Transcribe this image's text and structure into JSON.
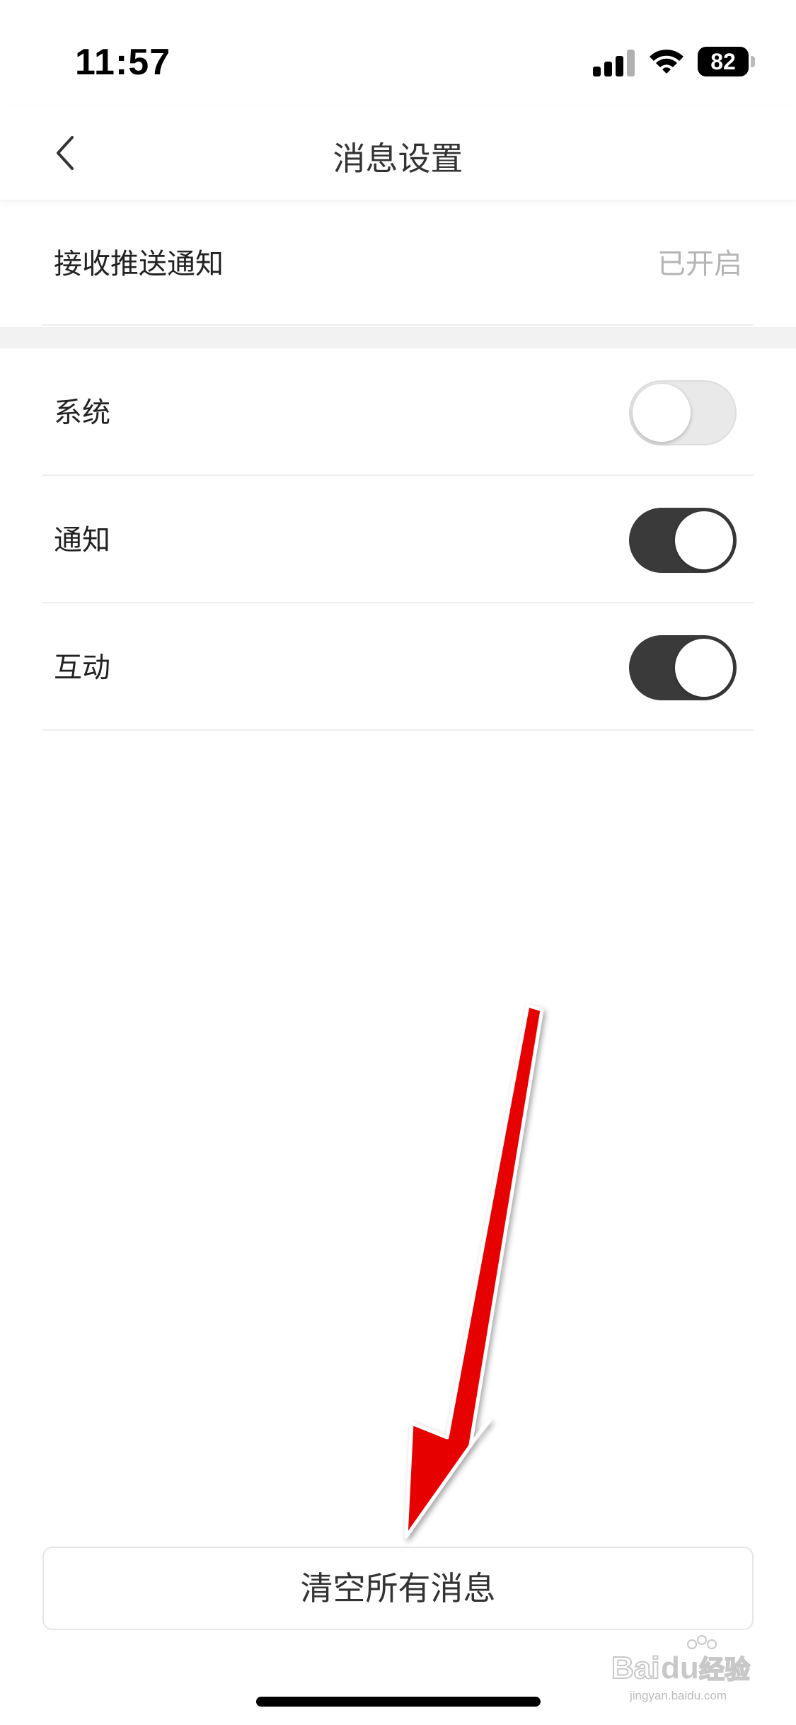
{
  "status_bar": {
    "time": "11:57",
    "battery": "82",
    "icons": [
      "signal-icon",
      "wifi-icon",
      "battery-icon"
    ]
  },
  "nav": {
    "title": "消息设置",
    "back_icon": "chevron-left-icon"
  },
  "push_setting": {
    "label": "接收推送通知",
    "value": "已开启"
  },
  "toggles": [
    {
      "label": "系统",
      "enabled": false
    },
    {
      "label": "通知",
      "enabled": true
    },
    {
      "label": "互动",
      "enabled": true
    }
  ],
  "clear_button": {
    "label": "清空所有消息"
  },
  "annotation": {
    "icon": "red-arrow-icon",
    "color": "#e60000"
  },
  "watermark": {
    "brand": "Baidu",
    "cn": "经验",
    "sub": "jingyan.baidu.com"
  },
  "colors": {
    "toggle_on": "#3a3a3a",
    "toggle_off": "#e9e9e9",
    "muted_text": "#b5b5b5",
    "arrow": "#e60000"
  }
}
